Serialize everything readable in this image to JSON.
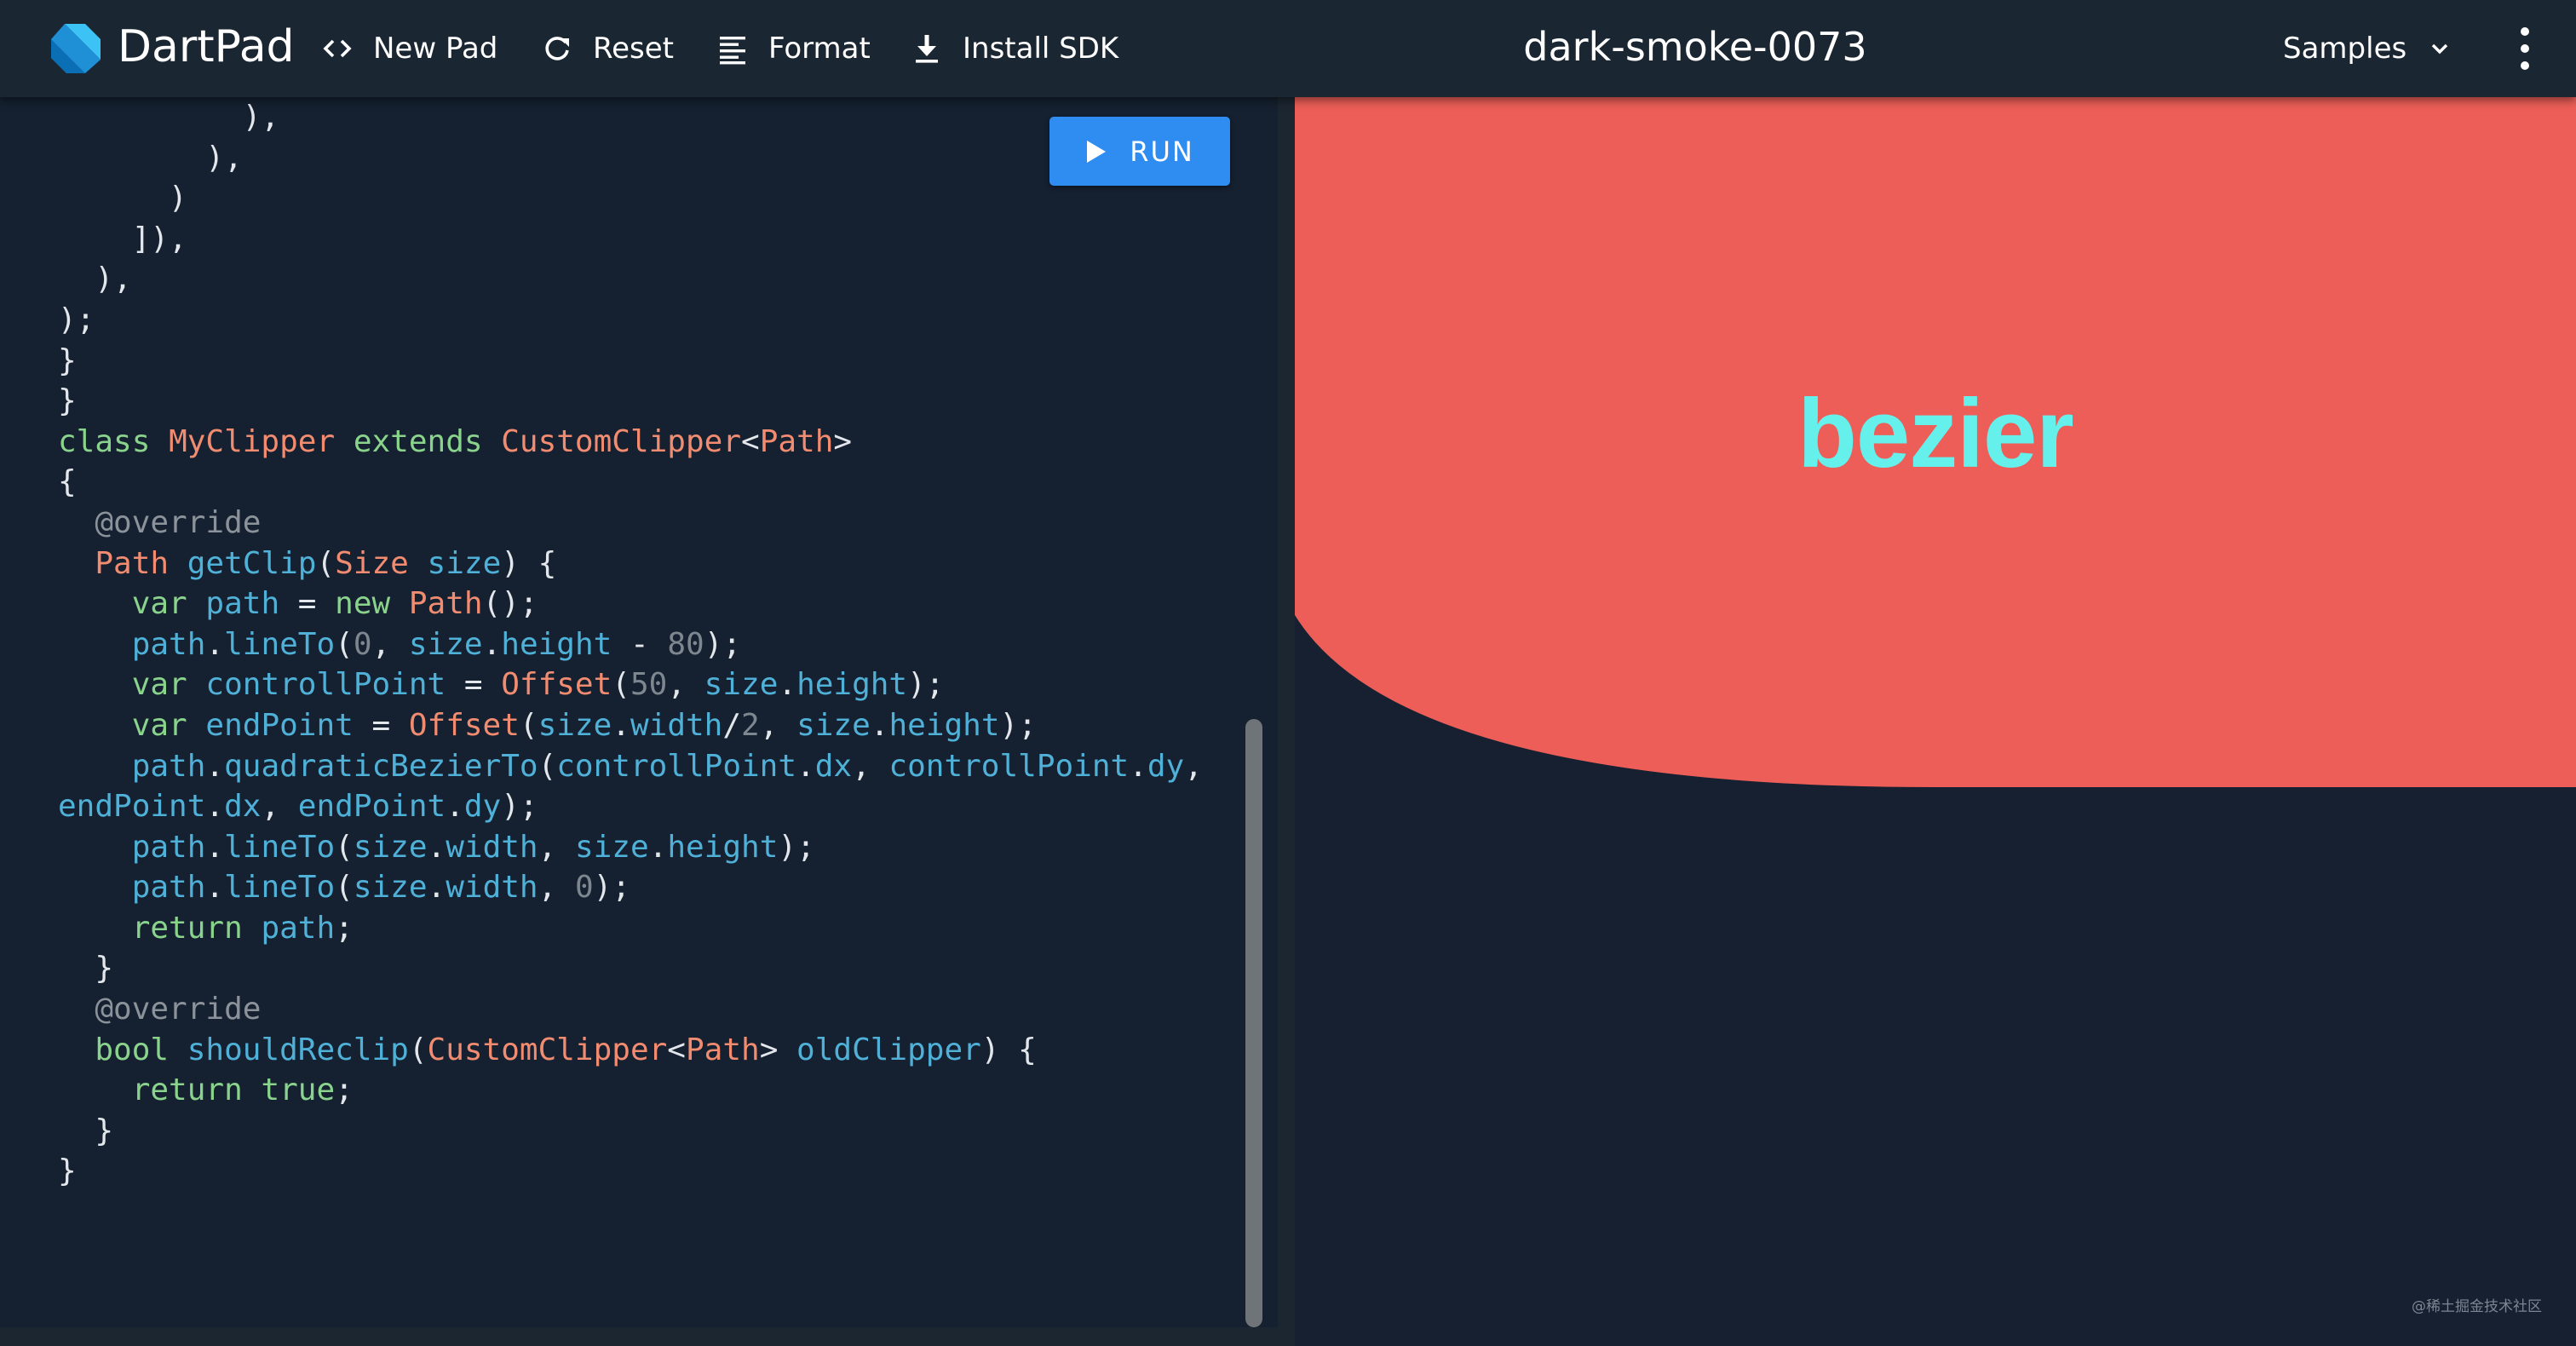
{
  "header": {
    "brand": "DartPad",
    "pad_title": "dark-smoke-0073",
    "buttons": {
      "new_pad": "New Pad",
      "reset": "Reset",
      "format": "Format",
      "install_sdk": "Install SDK"
    },
    "samples_label": "Samples",
    "icons": {
      "logo": "dart-logo-icon",
      "new_pad": "code-brackets-icon",
      "reset": "refresh-icon",
      "format": "format-lines-icon",
      "install_sdk": "download-icon",
      "samples": "chevron-down-icon",
      "more": "more-vert-icon"
    }
  },
  "editor": {
    "run_label": "RUN",
    "code_lines": [
      "          ),",
      "        ),",
      "      )",
      "    ]),",
      "  ),",
      ");",
      "}",
      "}",
      "",
      "class MyClipper extends CustomClipper<Path>",
      "{",
      "  @override",
      "  Path getClip(Size size) {",
      "    var path = new Path();",
      "    path.lineTo(0, size.height - 80);",
      "    var controllPoint = Offset(50, size.height);",
      "    var endPoint = Offset(size.width/2, size.height);",
      "    path.quadraticBezierTo(controllPoint.dx, controllPoint.dy,",
      "endPoint.dx, endPoint.dy);",
      "    path.lineTo(size.width, size.height);",
      "    path.lineTo(size.width, 0);",
      "    return path;",
      "  }",
      "",
      "  @override",
      "  bool shouldReclip(CustomClipper<Path> oldClipper) {",
      "    return true;",
      "  }",
      "}"
    ]
  },
  "preview": {
    "text": "bezier",
    "watermark": "@稀土掘金技术社区"
  },
  "colors": {
    "header_bg": "#1b2633",
    "editor_bg": "#152030",
    "run_button": "#2f8cf0",
    "clip_red": "#ec5e57",
    "bezier_text": "#66f0ec",
    "keyword_green": "#8ad38c",
    "type_orange": "#f18c71",
    "identifier_blue": "#4fb1d8"
  }
}
